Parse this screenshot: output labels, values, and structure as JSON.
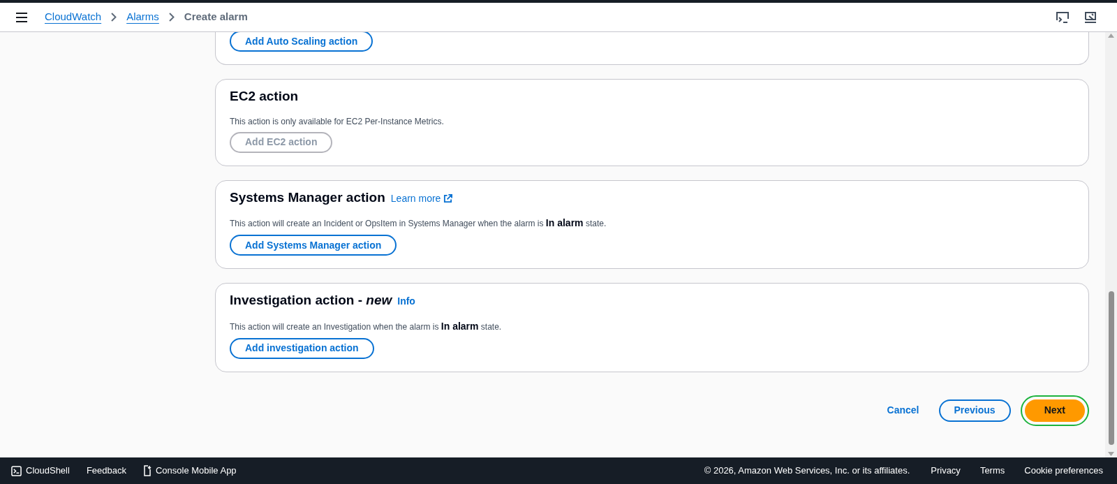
{
  "breadcrumbs": [
    {
      "label": "CloudWatch",
      "kind": "link"
    },
    {
      "label": "Alarms",
      "kind": "link"
    },
    {
      "label": "Create alarm",
      "kind": "current"
    }
  ],
  "sections": [
    {
      "kind": "partial",
      "button": {
        "label": "Add Auto Scaling action",
        "disabled": false
      }
    },
    {
      "kind": "full",
      "title": "EC2 action",
      "description": "This action is only available for EC2 Per-Instance Metrics.",
      "button": {
        "label": "Add EC2 action",
        "disabled": true
      }
    },
    {
      "kind": "full",
      "title": "Systems Manager action",
      "link": {
        "label": "Learn more",
        "kind": "external"
      },
      "description": "This action will create an Incident or OpsItem in Systems Manager when the alarm is **In alarm** state.",
      "button": {
        "label": "Add Systems Manager action",
        "disabled": false
      }
    },
    {
      "kind": "full",
      "title": "Investigation action - *new*",
      "link": {
        "label": "Info",
        "kind": "info"
      },
      "description": "This action will create an Investigation when the alarm is **In alarm** state.",
      "button": {
        "label": "Add investigation action",
        "disabled": false
      }
    }
  ],
  "actions": [
    {
      "label": "Cancel",
      "kind": "link"
    },
    {
      "label": "Previous",
      "kind": "secondary"
    },
    {
      "label": "Next",
      "kind": "primary",
      "highlighted": true
    }
  ],
  "footer": {
    "left": [
      "CloudShell",
      "Feedback",
      "Console Mobile App"
    ],
    "copyright": "© 2026, Amazon Web Services, Inc. or its affiliates.",
    "links": [
      "Privacy",
      "Terms",
      "Cookie preferences"
    ]
  }
}
